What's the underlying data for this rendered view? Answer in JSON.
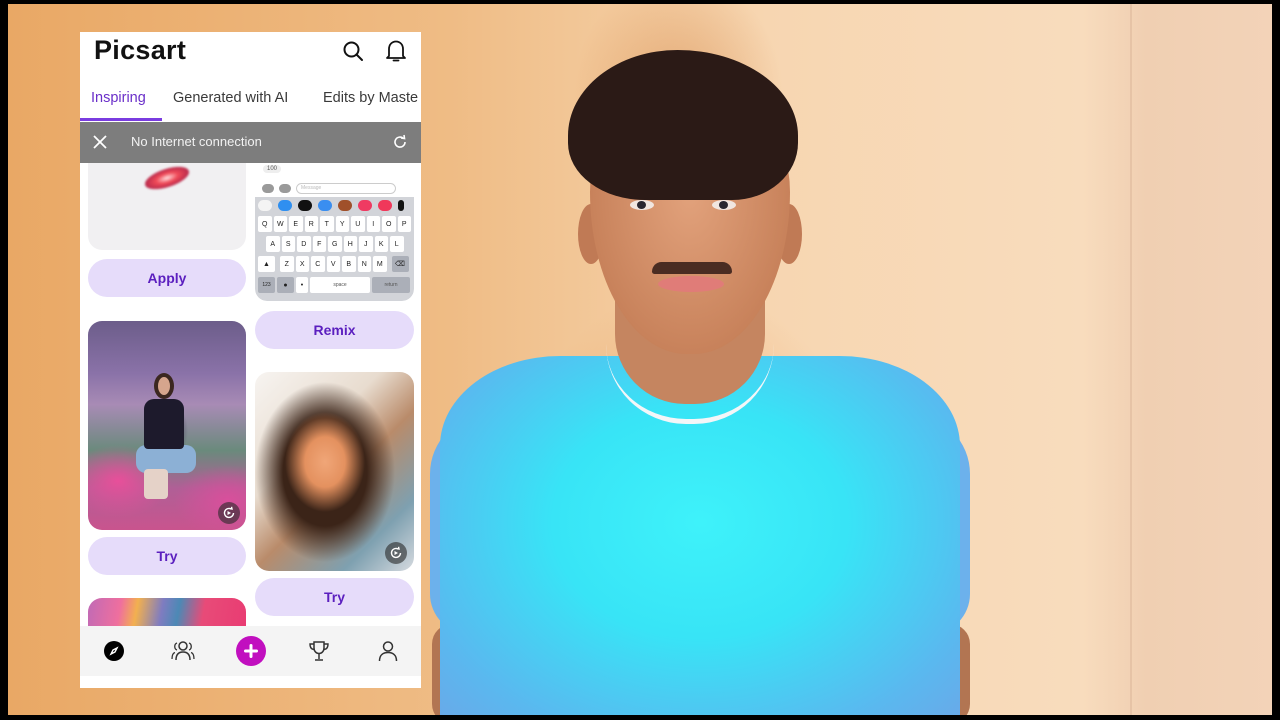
{
  "video": {
    "description": "Screen overlay of Picsart app over a person talking",
    "colors": {
      "background_wall": "#f3c99c",
      "shirt": "#3ee6f7",
      "letterbox": "#000000"
    }
  },
  "app": {
    "name": "Picsart",
    "accent_color": "#6a2fc9",
    "create_color": "#c10fbf",
    "header": {
      "logo": "Picsart",
      "icons": [
        "search-icon",
        "bell-icon"
      ]
    },
    "tabs": [
      {
        "label": "Inspiring",
        "active": true
      },
      {
        "label": "Generated with AI",
        "active": false
      },
      {
        "label": "Edits by Maste",
        "active": false
      }
    ],
    "offline_banner": {
      "message": "No Internet connection",
      "close_icon": "close-icon",
      "retry_icon": "refresh-icon"
    },
    "feed": {
      "cards": [
        {
          "id": "lips-card",
          "action": "Apply"
        },
        {
          "id": "keyboard-card",
          "action": "Remix",
          "badge": "100",
          "message_placeholder": "Message",
          "keyboard_rows": [
            [
              "Q",
              "W",
              "E",
              "R",
              "T",
              "Y",
              "U",
              "I",
              "O",
              "P"
            ],
            [
              "A",
              "S",
              "D",
              "F",
              "G",
              "H",
              "J",
              "K",
              "L"
            ],
            [
              "Z",
              "X",
              "C",
              "V",
              "B",
              "N",
              "M"
            ]
          ],
          "space_label": "space",
          "return_label": "return",
          "numbers_label": "123"
        },
        {
          "id": "fantasy-card",
          "action": "Try"
        },
        {
          "id": "portrait-card",
          "action": "Try"
        },
        {
          "id": "abstract-card",
          "action": ""
        }
      ]
    },
    "bottom_nav": [
      {
        "name": "explore",
        "icon": "compass-icon"
      },
      {
        "name": "community",
        "icon": "people-icon"
      },
      {
        "name": "create",
        "icon": "plus-icon"
      },
      {
        "name": "challenges",
        "icon": "trophy-icon"
      },
      {
        "name": "profile",
        "icon": "user-icon"
      }
    ]
  }
}
